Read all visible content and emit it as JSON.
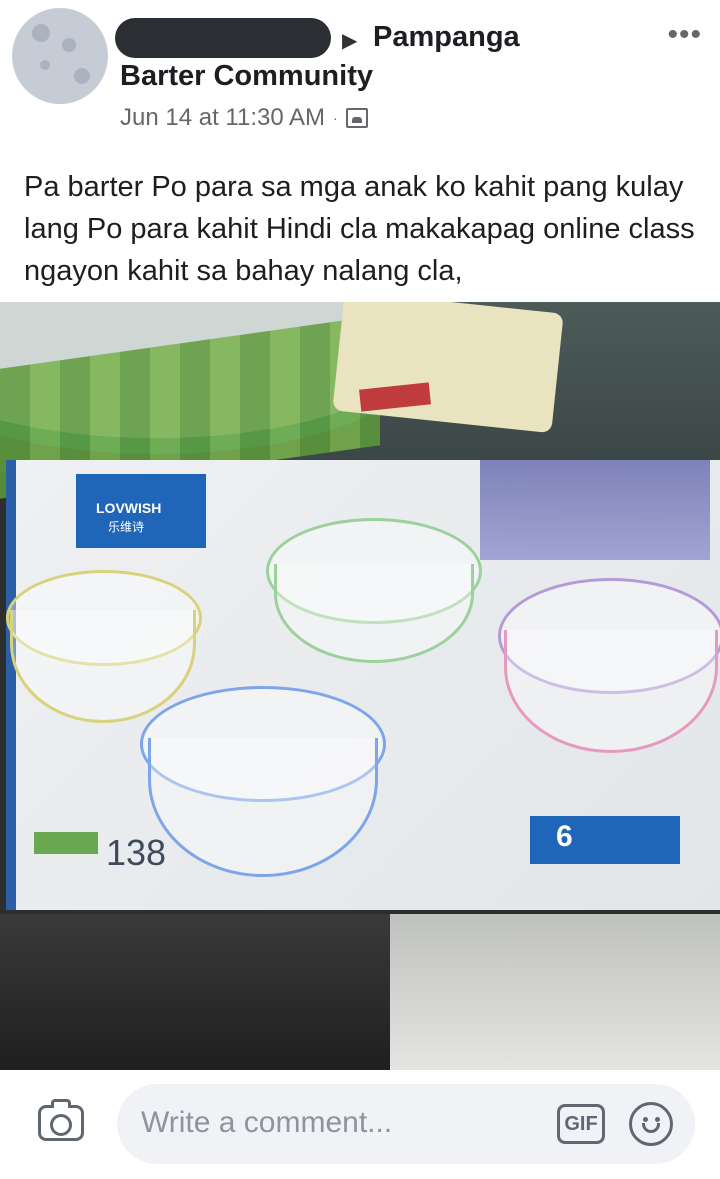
{
  "post": {
    "group_line1": "Pampanga",
    "group_line2": "Barter Community",
    "timestamp": "Jun 14 at 11:30 AM",
    "separator": "·",
    "body": "Pa barter Po para sa mga anak ko kahit pang kulay lang Po para kahit Hindi cla makakapag online class ngayon kahit sa bahay nalang cla,"
  },
  "photo": {
    "brand_text": "LOVWISH",
    "brand_sub": "乐维诗",
    "price": "138",
    "pcs_badge": "6"
  },
  "composer": {
    "placeholder": "Write a comment...",
    "gif_label": "GIF"
  },
  "icons": {
    "more": "more-options-icon",
    "privacy": "privacy-icon",
    "camera": "camera-icon",
    "gif": "gif-icon",
    "emoji": "emoji-icon"
  },
  "colors": {
    "text_primary": "#1c1e21",
    "text_secondary": "#65676b",
    "input_bg": "#f0f2f5"
  }
}
